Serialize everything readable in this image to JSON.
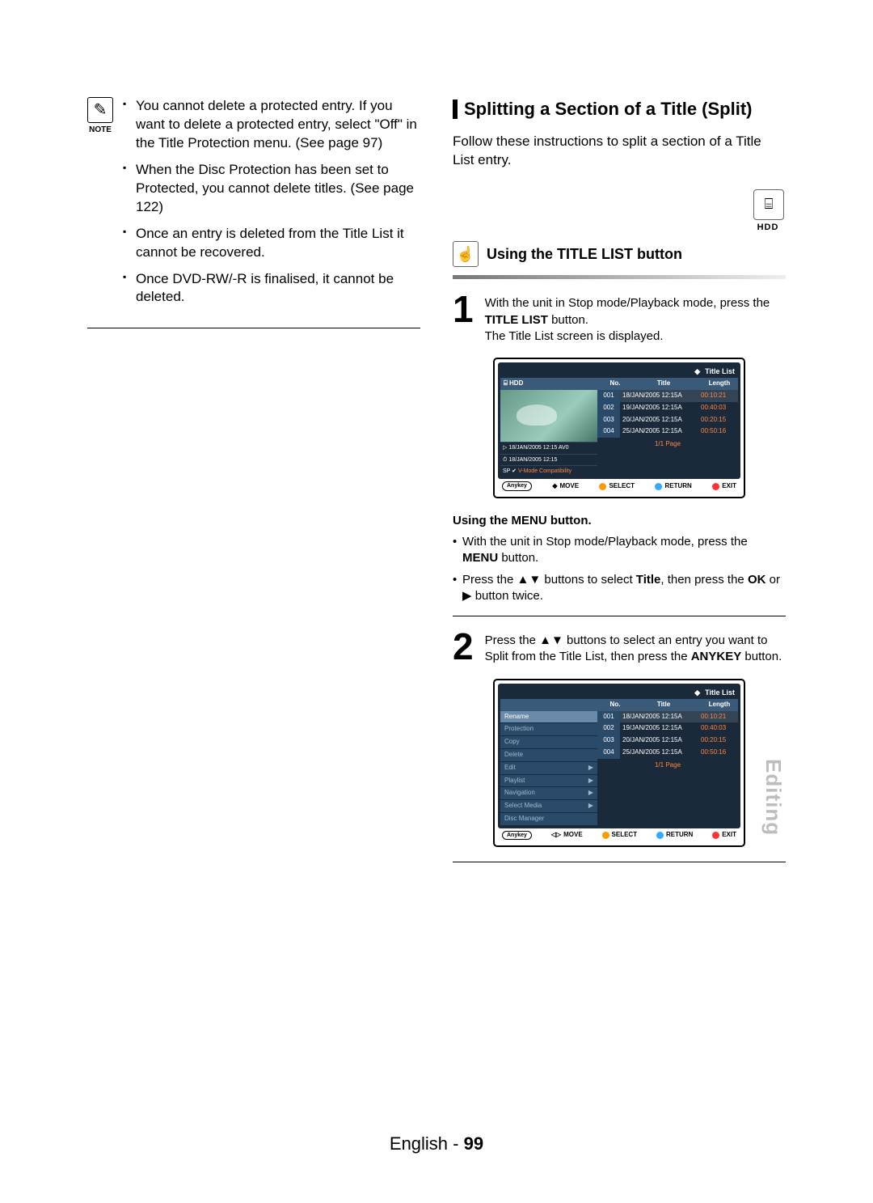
{
  "note_label": "NOTE",
  "notes": [
    "You cannot delete a protected entry. If you want to delete a protected entry, select \"Off\" in the Title Protection menu. (See page 97)",
    "When the Disc Protection has been set to Protected, you cannot delete titles. (See page 122)",
    "Once an entry is deleted from the Title List it cannot be recovered.",
    "Once DVD-RW/-R is finalised, it cannot be deleted."
  ],
  "heading": "Splitting a Section of a Title (Split)",
  "intro": "Follow these instructions to split a section of a Title List entry.",
  "hdd_label": "HDD",
  "subheading": "Using the TITLE LIST button",
  "step1": {
    "num": "1",
    "line1": "With the unit in Stop mode/Playback mode, press the ",
    "bold": "TITLE LIST",
    "line1b": " button.",
    "line2": "The Title List screen is displayed."
  },
  "osd": {
    "title": "Title List",
    "media": "HDD",
    "cols": {
      "no": "No.",
      "title": "Title",
      "length": "Length"
    },
    "rows": [
      {
        "no": "001",
        "title": "18/JAN/2005 12:15A",
        "len": "00:10:21"
      },
      {
        "no": "002",
        "title": "19/JAN/2005 12:15A",
        "len": "00:40:03"
      },
      {
        "no": "003",
        "title": "20/JAN/2005 12:15A",
        "len": "00:20:15"
      },
      {
        "no": "004",
        "title": "25/JAN/2005 12:15A",
        "len": "00:50:16"
      }
    ],
    "meta1": "18/JAN/2005 12:15 AV0",
    "meta2": "18/JAN/2005 12:15",
    "meta3a": "SP ",
    "meta3b": "V-Mode Compatibility",
    "page": "1/1 Page",
    "anykey": "Anykey",
    "foot": {
      "move": "MOVE",
      "select": "SELECT",
      "return": "RETURN",
      "exit": "EXIT"
    }
  },
  "menu_sub_title": "Using the MENU button.",
  "menu_sub_items": [
    "With the unit in Stop mode/Playback mode, press the MENU button.",
    "Press the ▲▼ buttons to select Title, then press the OK or ▶ button twice."
  ],
  "step2": {
    "num": "2",
    "line1": "Press the ▲▼ buttons to select an entry you want to Split from the Title List, then press the ",
    "bold": "ANYKEY",
    "line1b": " button."
  },
  "osd2_menu": [
    "Rename",
    "Protection",
    "Copy",
    "Delete",
    "Edit",
    "Playlist",
    "Navigation",
    "Select Media",
    "Disc Manager"
  ],
  "osd2_menu_arrows": {
    "Edit": "▶",
    "Playlist": "▶",
    "Navigation": "▶",
    "Select Media": "▶"
  },
  "side_tab": "Editing",
  "footer_lang": "English - ",
  "footer_page": "99"
}
